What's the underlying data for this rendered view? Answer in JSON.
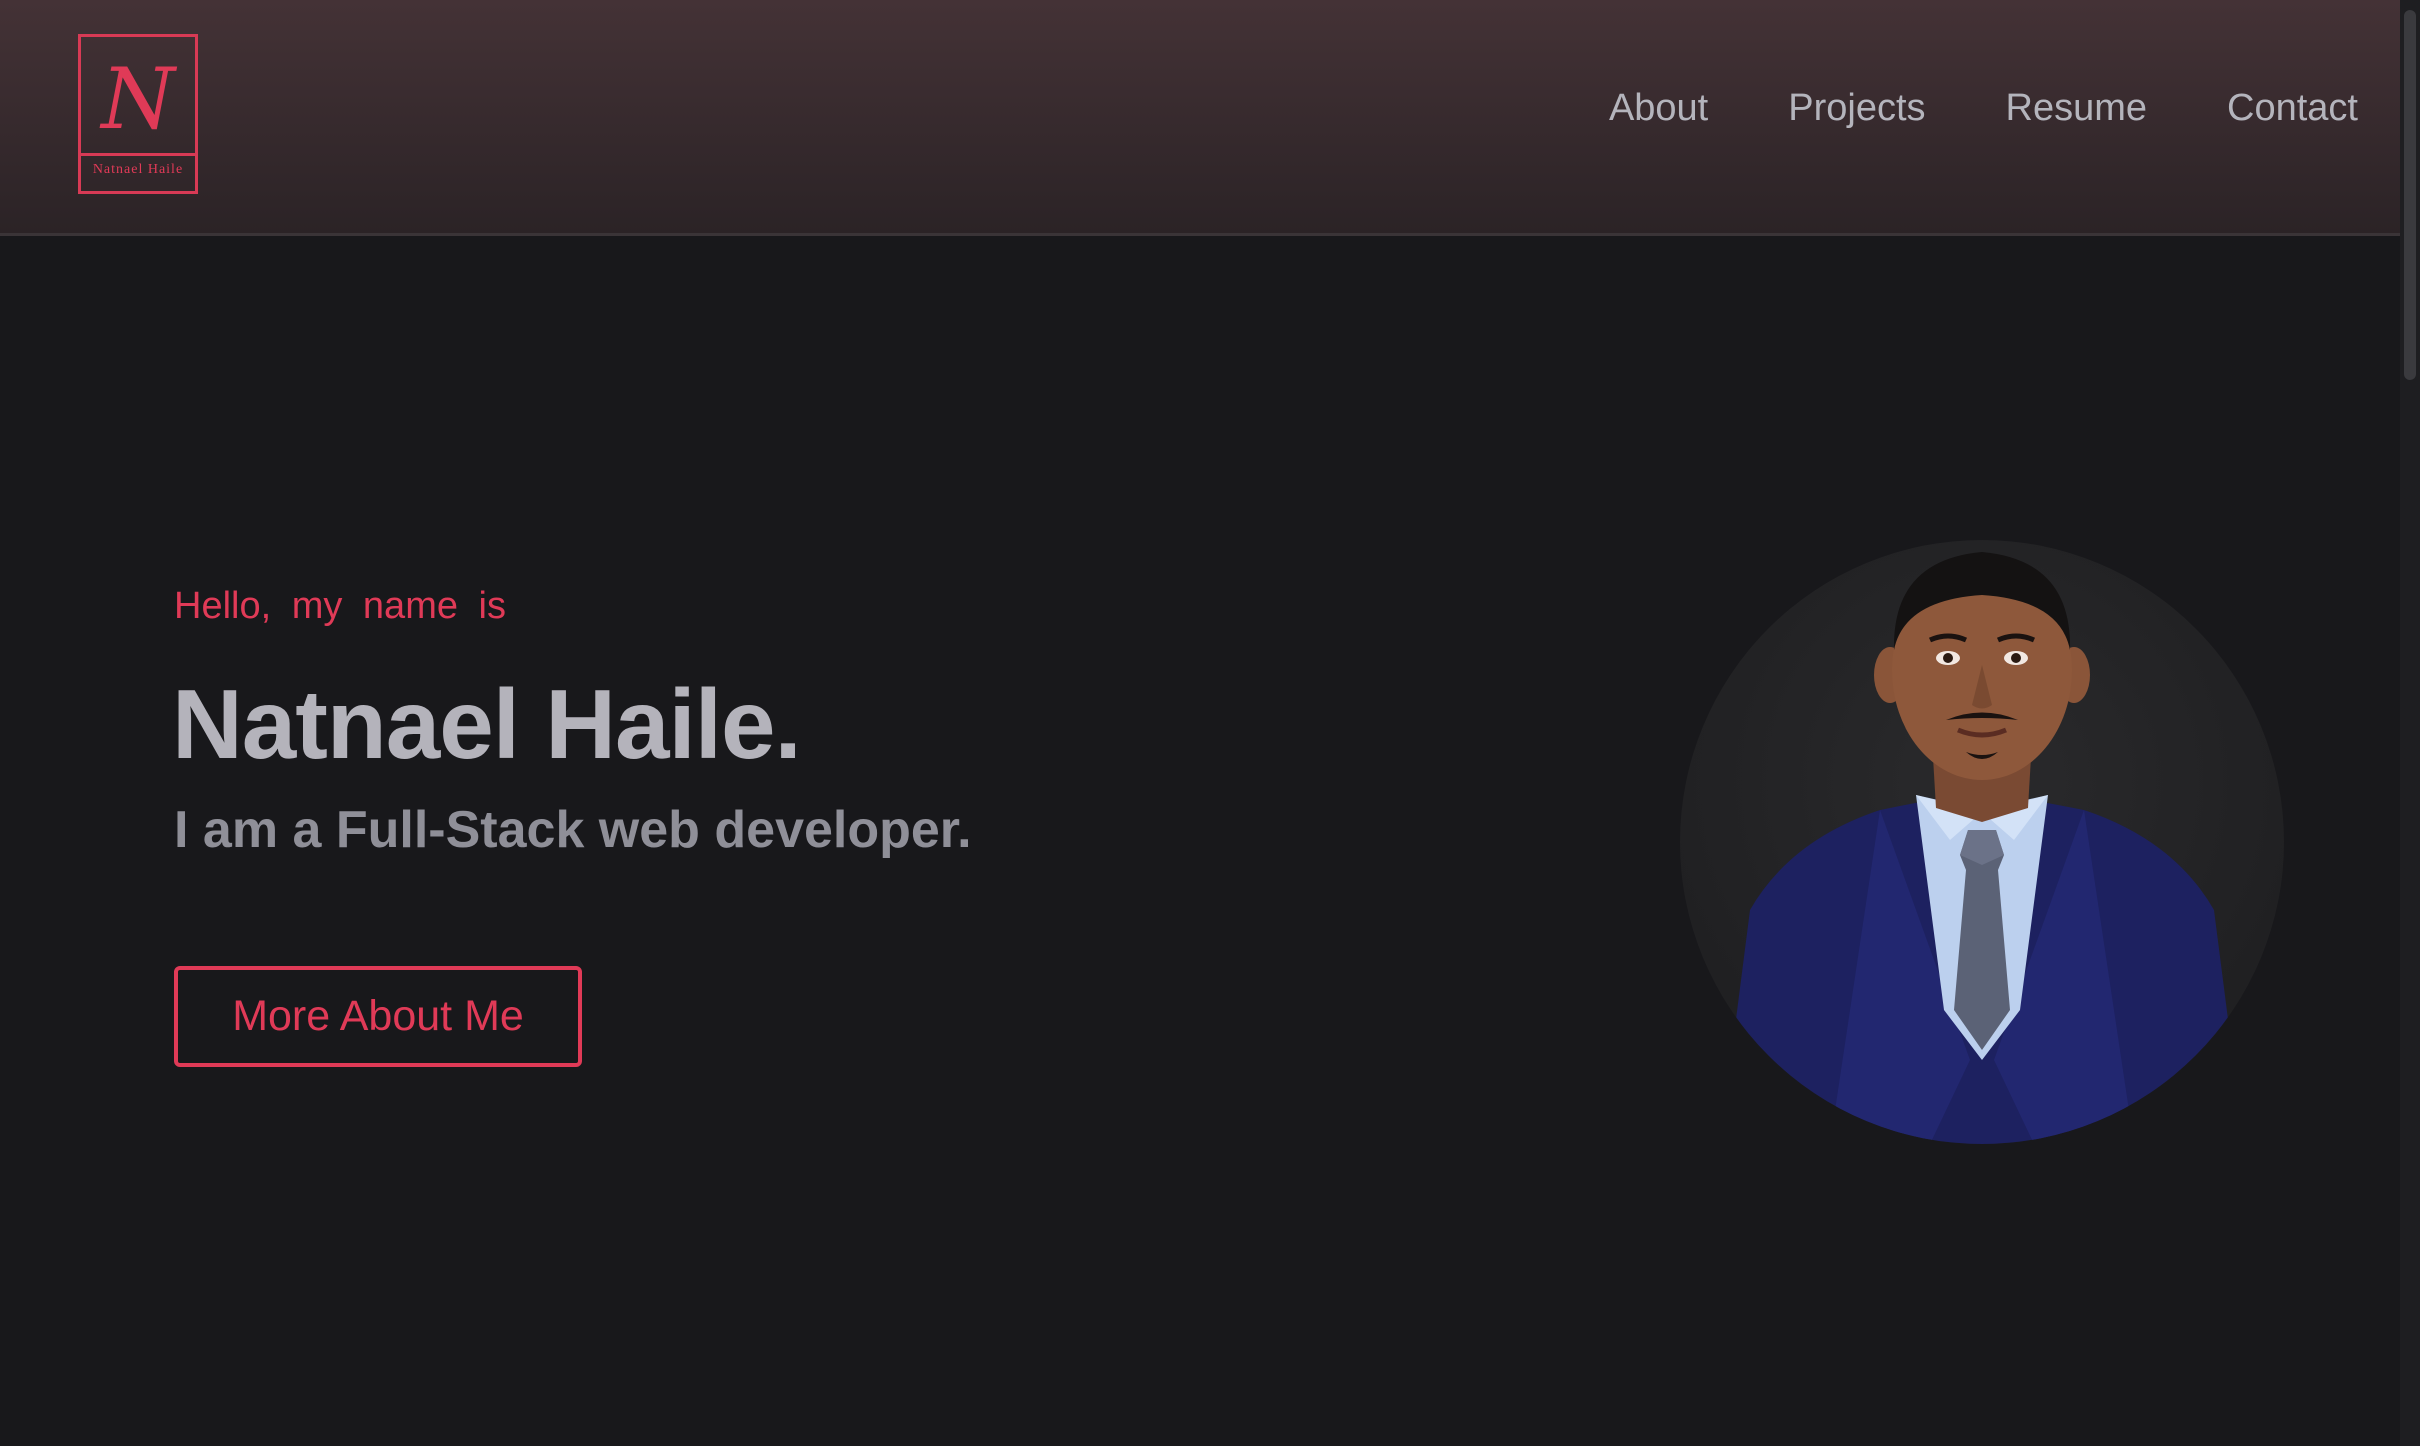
{
  "logo": {
    "letter": "N",
    "name": "Natnael Haile"
  },
  "nav": {
    "items": [
      {
        "label": "About"
      },
      {
        "label": "Projects"
      },
      {
        "label": "Resume"
      },
      {
        "label": "Contact"
      }
    ]
  },
  "hero": {
    "greeting": "Hello, my name is",
    "name": "Natnael Haile.",
    "tagline": "I am a Full-Stack web developer.",
    "cta_label": "More About Me"
  },
  "colors": {
    "accent": "#e03a57",
    "background": "#18181b",
    "header_top": "#443236",
    "text_primary": "#b4b3bb",
    "text_secondary": "#8f8f98"
  },
  "icons": {
    "portrait": "profile-photo"
  }
}
